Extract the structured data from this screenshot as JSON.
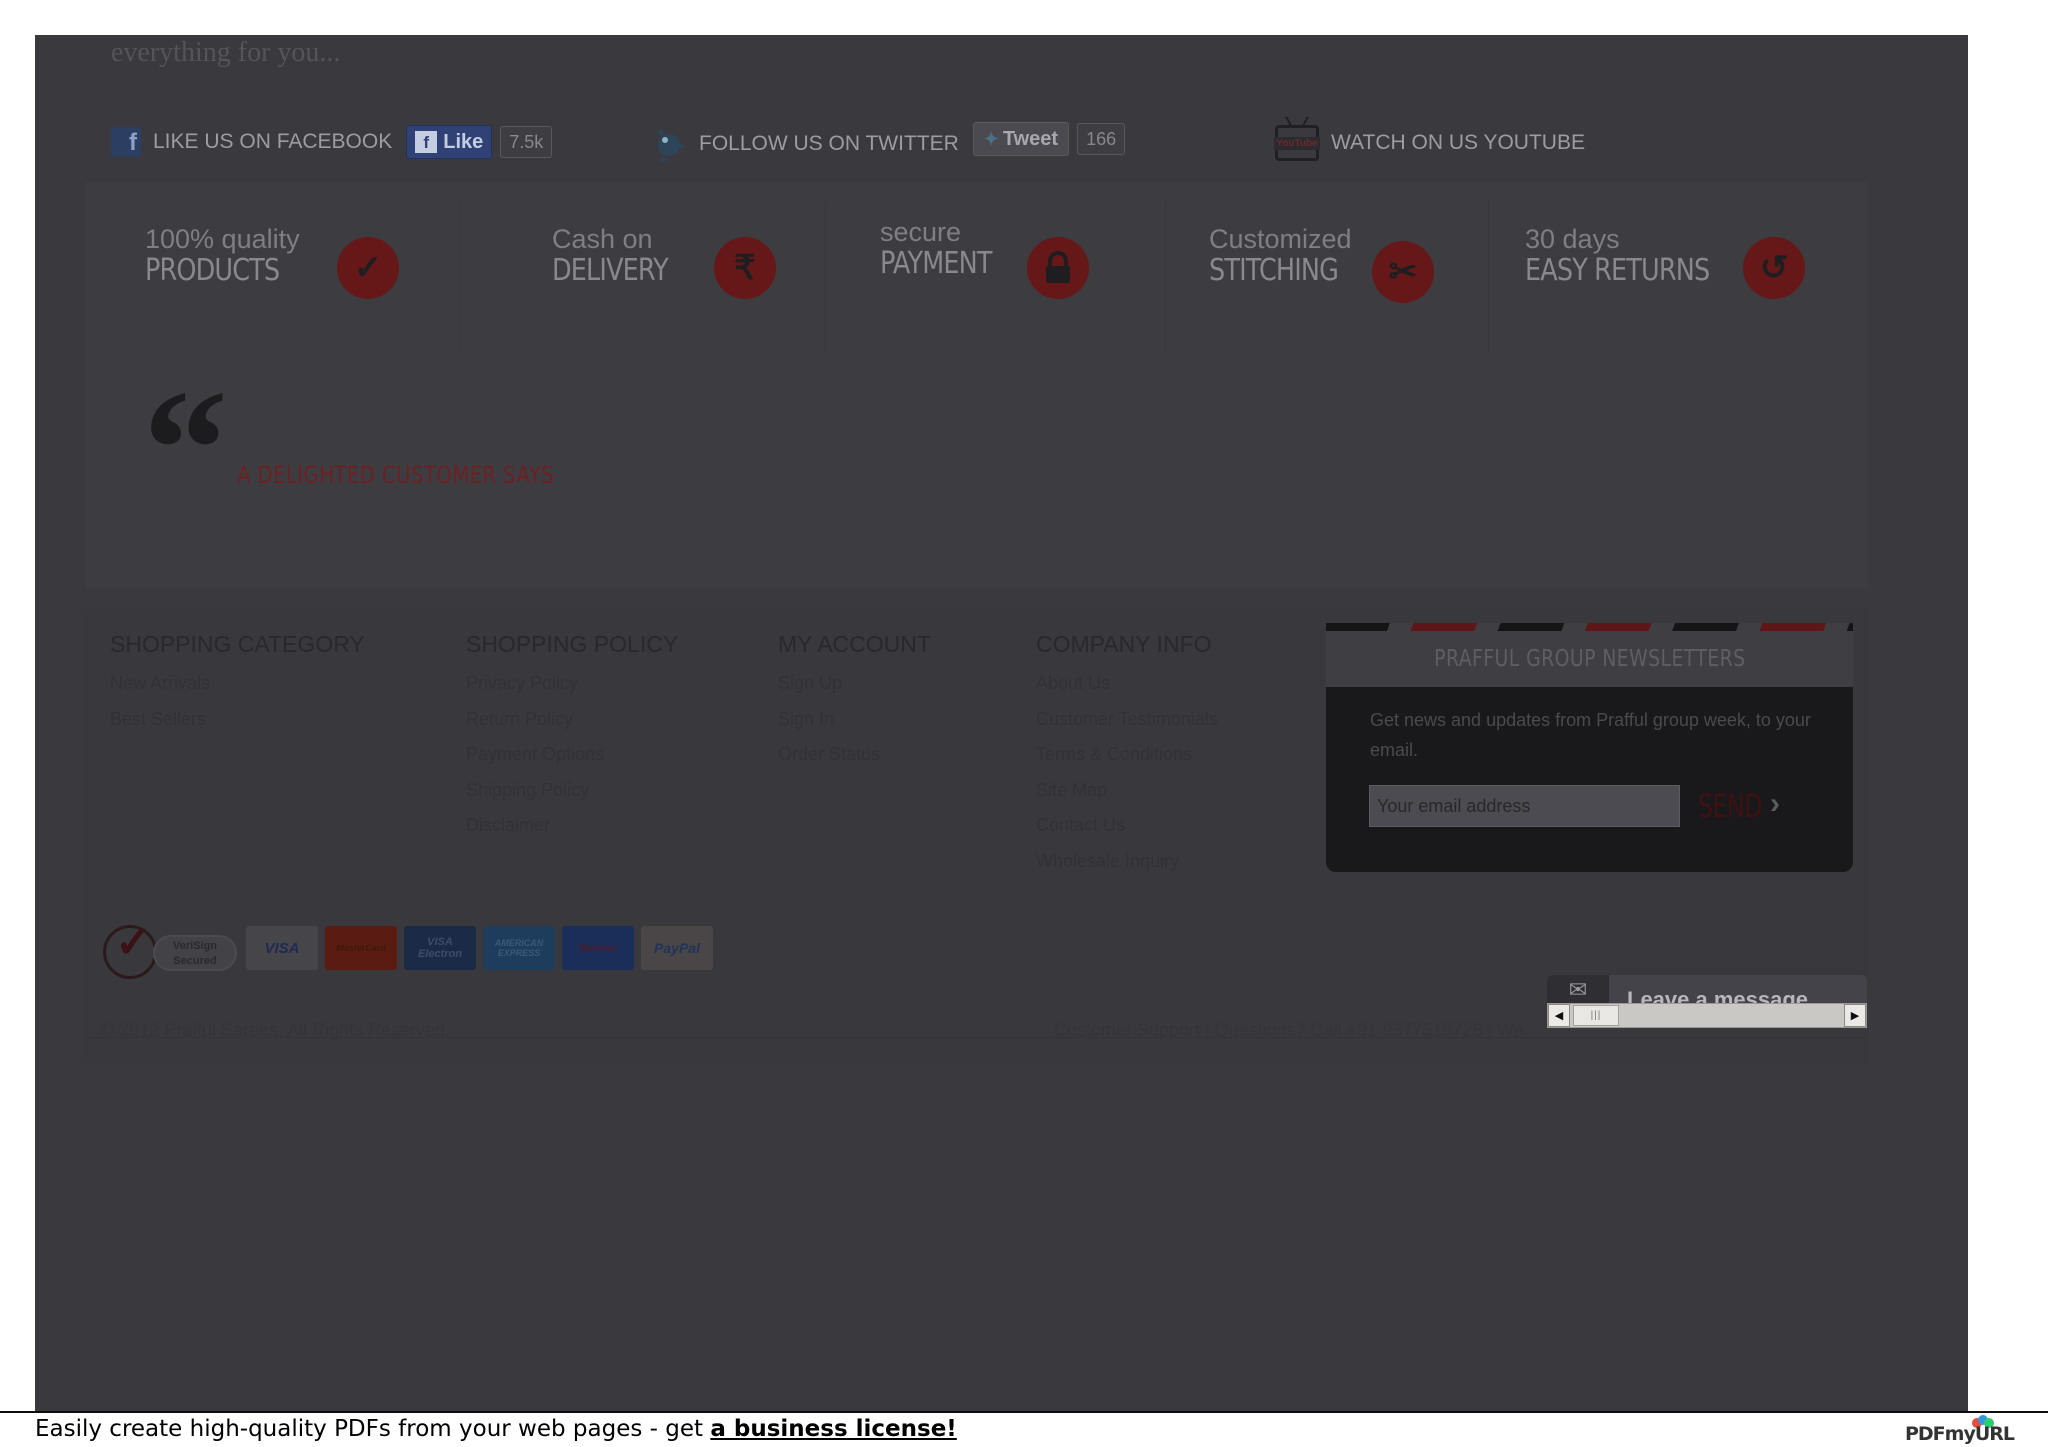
{
  "tagline": "everything for you...",
  "social": {
    "facebook_label": "LIKE US ON FACEBOOK",
    "facebook_button": "Like",
    "facebook_count": "7.5k",
    "twitter_label": "FOLLOW US ON TWITTER",
    "twitter_button": "Tweet",
    "twitter_count": "166",
    "youtube_label": "WATCH ON US YOUTUBE"
  },
  "features": [
    {
      "small": "100% quality",
      "big": "PRODUCTS",
      "icon": "check-icon"
    },
    {
      "small": "Cash on",
      "big": "DELIVERY",
      "icon": "rupee-icon"
    },
    {
      "small": "secure",
      "big": "PAYMENT",
      "icon": "lock-icon"
    },
    {
      "small": "Customized",
      "big": "STITCHING",
      "icon": "scissors-icon"
    },
    {
      "small": "30 days",
      "big": "EASY RETURNS",
      "icon": "return-icon"
    }
  ],
  "testimonial_heading": "A DELIGHTED CUSTOMER SAYS",
  "footer": {
    "shopping_category": {
      "title": "SHOPPING CATEGORY",
      "links": [
        "New Arrivals",
        "Best Sellers"
      ]
    },
    "shopping_policy": {
      "title": "SHOPPING POLICY",
      "links": [
        "Privacy Policy",
        "Return Policy",
        "Payment Options",
        "Shipping Policy",
        "Disclaimer"
      ]
    },
    "my_account": {
      "title": "MY ACCOUNT",
      "links": [
        "Sign Up",
        "Sign In",
        "Order Status"
      ]
    },
    "company_info": {
      "title": "COMPANY INFO",
      "links": [
        "About Us",
        "Customer Testimonials",
        "Terms & Conditions",
        "Site Map",
        "Contact Us",
        "Wholesale Inquiry"
      ]
    }
  },
  "newsletter": {
    "title": "PRAFFUL GROUP NEWSLETTERS",
    "description": "Get news and updates from Prafful group week, to your email.",
    "placeholder": "Your email address",
    "send_label": "SEND"
  },
  "payment_logos": {
    "verisign": "VeriSign Secured",
    "cards": [
      "VISA",
      "MasterCard",
      "VISA Electron",
      "AMERICAN EXPRESS",
      "Maestro",
      "PayPal"
    ]
  },
  "copyright": "© 2012 Prafful Sarees. All Rights Reserved.",
  "support_text": "Customer Support  |  Questions? Call +91 9377515728  |  We",
  "chat": {
    "label": "Leave a message"
  },
  "bottom_bar": {
    "text": "Easily create high-quality PDFs from your web pages - get ",
    "link": "a business license!",
    "logo": "PDFmyURL"
  },
  "colors": {
    "accent_red": "#661718",
    "overlay": "#3a393e"
  }
}
